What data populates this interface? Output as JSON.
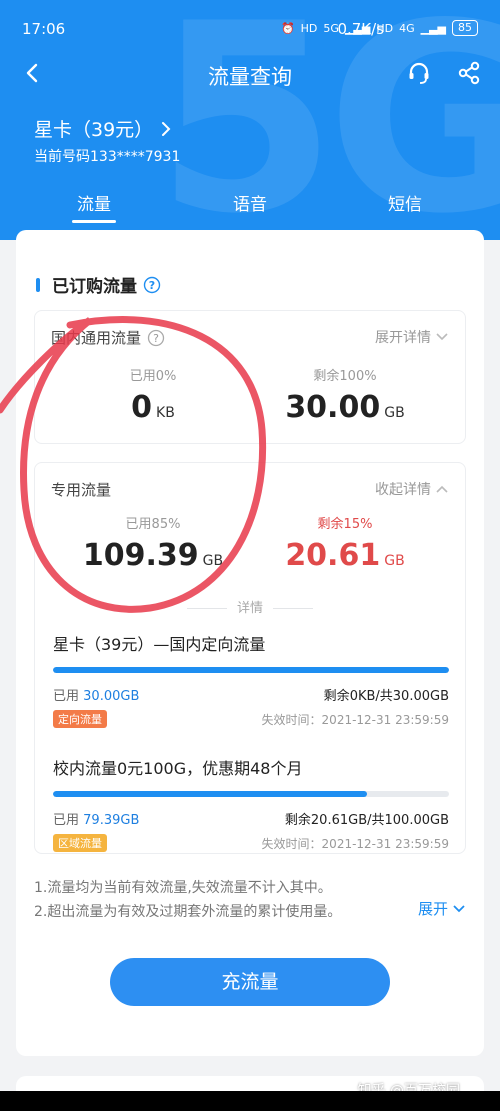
{
  "status_bar": {
    "time": "17:06",
    "speed": "0.7K/s",
    "hd1": "HD",
    "net1": "5G",
    "hd2": "HD",
    "net2": "4G",
    "battery": "85"
  },
  "nav": {
    "title": "流量查询"
  },
  "plan": {
    "name": "星卡（39元）",
    "phone": "当前号码133****7931"
  },
  "tabs": [
    {
      "label": "流量",
      "active": true
    },
    {
      "label": "语音"
    },
    {
      "label": "短信"
    }
  ],
  "section": {
    "title": "已订购流量"
  },
  "domestic": {
    "title": "国内通用流量",
    "toggle": "展开详情",
    "used_label": "已用0%",
    "used_value": "0",
    "used_unit": "KB",
    "remain_label": "剩余100%",
    "remain_value": "30.00",
    "remain_unit": "GB"
  },
  "special": {
    "title": "专用流量",
    "toggle": "收起详情",
    "used_label": "已用85%",
    "used_value": "109.39",
    "used_unit": "GB",
    "remain_label": "剩余15%",
    "remain_value": "20.61",
    "remain_unit": "GB",
    "divider": "详情",
    "items": [
      {
        "title": "星卡（39元）—国内定向流量",
        "progress": 1.0,
        "used_prefix": "已用",
        "used": "30.00GB",
        "remain_prefix": "剩余",
        "remain": "0KB",
        "total": "/共30.00GB",
        "tag": "定向流量",
        "expire": "失效时间：2021-12-31 23:59:59"
      },
      {
        "title": "校内流量0元100G，优惠期48个月",
        "progress": 0.794,
        "used_prefix": "已用",
        "used": "79.39GB",
        "remain_prefix": "剩余",
        "remain": "20.61GB",
        "total": "/共100.00GB",
        "tag": "区域流量",
        "expire": "失效时间：2021-12-31 23:59:59"
      }
    ]
  },
  "notes": [
    "1.流量均为当前有效流量,失效流量不计入其中。",
    "2.超出流量为有效及过期套外流量的累计使用量。"
  ],
  "expand_label": "展开",
  "cta_label": "充流量",
  "watermark": "知乎 @百万校园",
  "colors": {
    "primary": "#1e8ef1",
    "remain_red": "#e04a4a",
    "tag_orange": "#f37b48",
    "tag_yellow": "#f5b43f"
  }
}
